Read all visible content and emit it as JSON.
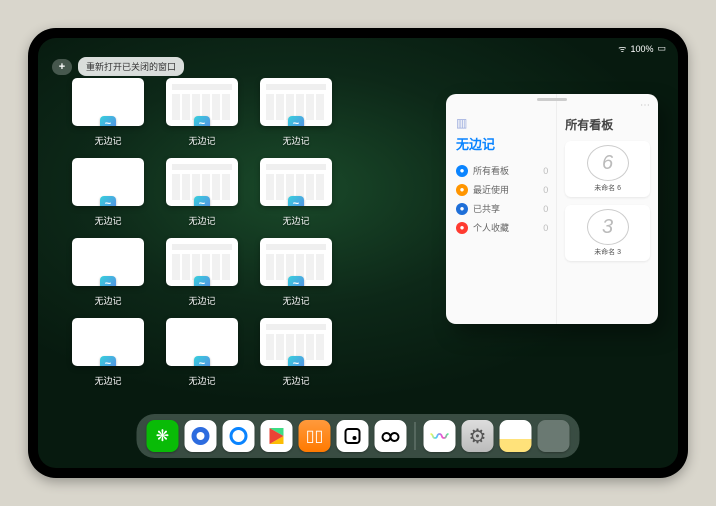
{
  "statusbar": {
    "time": "",
    "battery": "100%"
  },
  "topbar": {
    "plus": "+",
    "reopen": "重新打开已关闭的窗口"
  },
  "windows": [
    {
      "label": "无边记",
      "variant": "blank"
    },
    {
      "label": "无边记",
      "variant": "grid"
    },
    {
      "label": "无边记",
      "variant": "grid"
    },
    {
      "label": "无边记",
      "variant": "blank"
    },
    {
      "label": "无边记",
      "variant": "grid"
    },
    {
      "label": "无边记",
      "variant": "grid"
    },
    {
      "label": "无边记",
      "variant": "blank"
    },
    {
      "label": "无边记",
      "variant": "grid"
    },
    {
      "label": "无边记",
      "variant": "grid"
    },
    {
      "label": "无边记",
      "variant": "blank"
    },
    {
      "label": "无边记",
      "variant": "blank"
    },
    {
      "label": "无边记",
      "variant": "grid"
    }
  ],
  "panel": {
    "left_title": "无边记",
    "folders": [
      {
        "icon": "grid",
        "color": "#0a84ff",
        "label": "所有看板",
        "count": "0"
      },
      {
        "icon": "clock",
        "color": "#ff9500",
        "label": "最近使用",
        "count": "0"
      },
      {
        "icon": "person",
        "color": "#1e6fd8",
        "label": "已共享",
        "count": "0"
      },
      {
        "icon": "heart",
        "color": "#ff3b30",
        "label": "个人收藏",
        "count": "0"
      }
    ],
    "right_title": "所有看板",
    "boards": [
      {
        "sketch": "6",
        "label": "未命名 6",
        "sub": ""
      },
      {
        "sketch": "3",
        "label": "未命名 3",
        "sub": ""
      }
    ]
  },
  "dock": [
    {
      "name": "wechat",
      "glyph": "✺"
    },
    {
      "name": "qqhd",
      "glyph": ""
    },
    {
      "name": "qqbrowse",
      "glyph": ""
    },
    {
      "name": "play",
      "glyph": ""
    },
    {
      "name": "books",
      "glyph": "▯▯"
    },
    {
      "name": "dots1",
      "glyph": ""
    },
    {
      "name": "dots2",
      "glyph": ""
    },
    {
      "name": "sep"
    },
    {
      "name": "freeform",
      "glyph": "〰"
    },
    {
      "name": "settings",
      "glyph": "⚙"
    },
    {
      "name": "notes",
      "glyph": ""
    },
    {
      "name": "library",
      "glyph": ""
    }
  ]
}
